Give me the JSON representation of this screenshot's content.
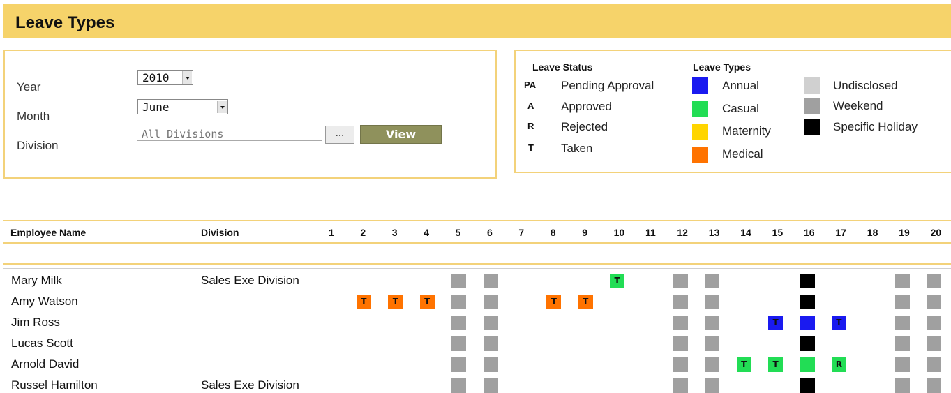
{
  "page": {
    "title": "Leave Types"
  },
  "filters": {
    "year_label": "Year",
    "year_value": "2010",
    "month_label": "Month",
    "month_value": "June",
    "division_label": "Division",
    "division_placeholder": "All Divisions",
    "browse_label": "...",
    "view_label": "View"
  },
  "legend": {
    "status_title": "Leave Status",
    "status": [
      {
        "code": "PA",
        "label": "Pending Approval"
      },
      {
        "code": "A",
        "label": "Approved"
      },
      {
        "code": "R",
        "label": "Rejected"
      },
      {
        "code": "T",
        "label": "Taken"
      }
    ],
    "types_title": "Leave Types",
    "types": [
      {
        "label": "Annual",
        "color": "#1a1af0"
      },
      {
        "label": "Casual",
        "color": "#22dd55"
      },
      {
        "label": "Maternity",
        "color": "#ffd500"
      },
      {
        "label": "Medical",
        "color": "#ff7300"
      }
    ],
    "other": [
      {
        "label": "Undisclosed",
        "color": "#d0d0d0"
      },
      {
        "label": "Weekend",
        "color": "#a0a0a0"
      },
      {
        "label": "Specific Holiday",
        "color": "#000000"
      }
    ]
  },
  "grid": {
    "col_employee": "Employee Name",
    "col_division": "Division",
    "days": [
      "1",
      "2",
      "3",
      "4",
      "5",
      "6",
      "7",
      "8",
      "9",
      "10",
      "11",
      "12",
      "13",
      "14",
      "15",
      "16",
      "17",
      "18",
      "19",
      "20"
    ],
    "weekend_days": [
      5,
      6,
      12,
      13,
      19,
      20
    ],
    "holiday_days": [
      16
    ],
    "rows": [
      {
        "name": "Mary Milk",
        "division": "Sales Exe Division",
        "leaves": [
          {
            "day": 10,
            "type": "Casual",
            "status": "T"
          }
        ]
      },
      {
        "name": "Amy Watson",
        "division": "",
        "leaves": [
          {
            "day": 2,
            "type": "Medical",
            "status": "T"
          },
          {
            "day": 3,
            "type": "Medical",
            "status": "T"
          },
          {
            "day": 4,
            "type": "Medical",
            "status": "T"
          },
          {
            "day": 8,
            "type": "Medical",
            "status": "T"
          },
          {
            "day": 9,
            "type": "Medical",
            "status": "T"
          }
        ]
      },
      {
        "name": "Jim Ross",
        "division": "",
        "leaves": [
          {
            "day": 15,
            "type": "Annual",
            "status": "T"
          },
          {
            "day": 16,
            "type": "Annual",
            "status": ""
          },
          {
            "day": 17,
            "type": "Annual",
            "status": "T"
          }
        ]
      },
      {
        "name": "Lucas Scott",
        "division": "",
        "leaves": []
      },
      {
        "name": "Arnold David",
        "division": "",
        "leaves": [
          {
            "day": 14,
            "type": "Casual",
            "status": "T"
          },
          {
            "day": 15,
            "type": "Casual",
            "status": "T"
          },
          {
            "day": 16,
            "type": "Casual",
            "status": ""
          },
          {
            "day": 17,
            "type": "Casual",
            "status": "R"
          }
        ]
      },
      {
        "name": "Russel Hamilton",
        "division": "Sales Exe Division",
        "leaves": []
      }
    ]
  }
}
